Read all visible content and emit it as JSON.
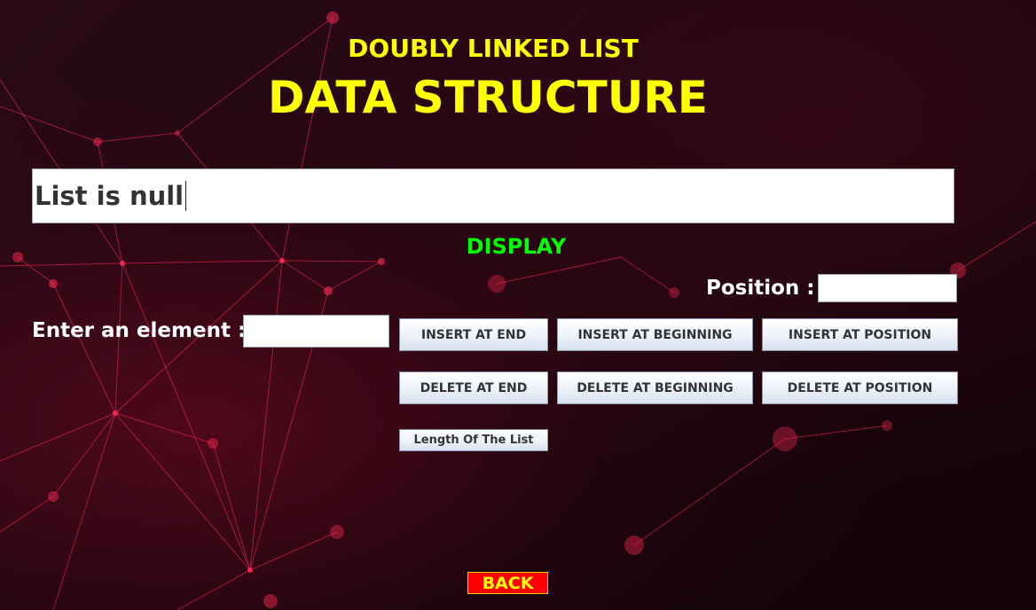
{
  "header": {
    "subtitle": "DOUBLY LINKED LIST",
    "title": "DATA STRUCTURE"
  },
  "display": {
    "value": "List is null",
    "label": "DISPLAY"
  },
  "position": {
    "label": "Position :",
    "value": ""
  },
  "element": {
    "label": "Enter an element :",
    "value": ""
  },
  "buttons": {
    "insert_end": "INSERT AT END",
    "insert_beginning": "INSERT AT BEGINNING",
    "insert_position": "INSERT AT POSITION",
    "delete_end": "DELETE AT END",
    "delete_beginning": "DELETE AT BEGINNING",
    "delete_position": "DELETE AT POSITION",
    "length": "Length Of The List",
    "back": "BACK"
  },
  "colors": {
    "title": "#ffff00",
    "display_label": "#00ff00",
    "back_background": "#ff0000",
    "back_text": "#ffff00",
    "network_lines": "#ff2a55"
  }
}
